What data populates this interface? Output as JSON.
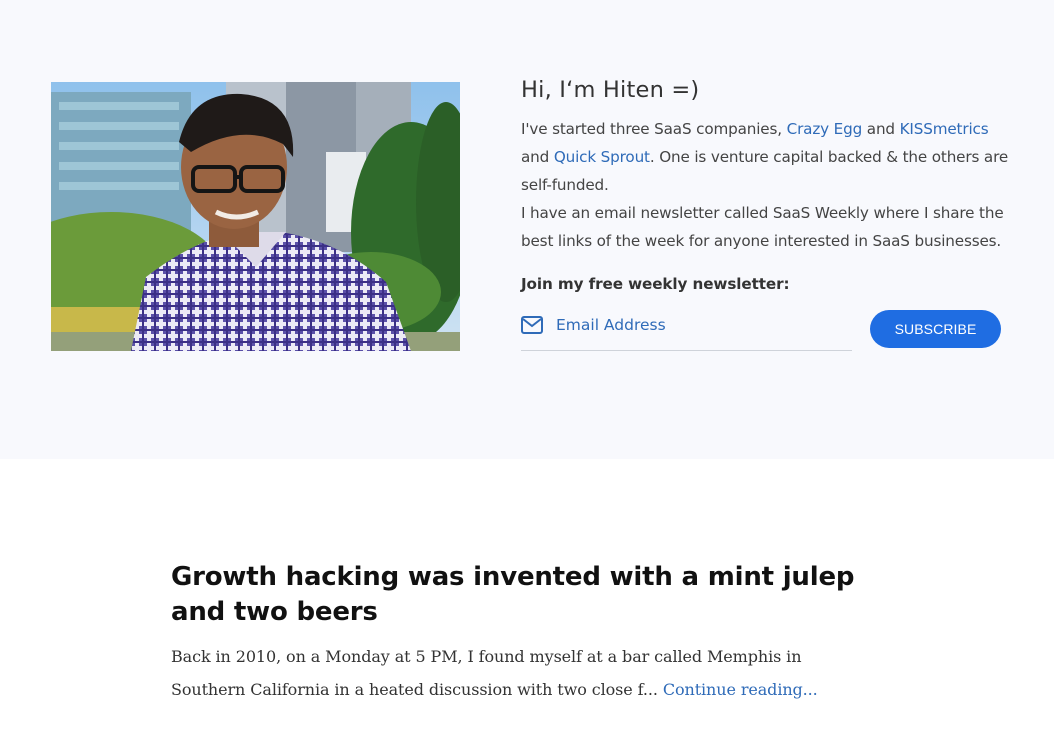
{
  "hero": {
    "greeting": "Hi, I‘m Hiten =)",
    "intro_prefix": "I've started three SaaS companies, ",
    "links": {
      "crazy_egg": "Crazy Egg",
      "kissmetrics": "KISSmetrics",
      "quick_sprout": "Quick Sprout"
    },
    "and_1": " and ",
    "and_2": "and ",
    "intro_suffix": ". One is venture capital backed & the others are self-funded.",
    "newsletter_text": "I have an email newsletter called SaaS Weekly where I share the best links of the week for anyone interested in SaaS businesses.",
    "join_label": "Join my free weekly newsletter:",
    "email_placeholder": "Email Address",
    "subscribe_label": "SUBSCRIBE",
    "photo_icon": "profile-photo"
  },
  "post": {
    "title": "Growth hacking was invented with a mint julep and two beers",
    "excerpt": "Back in 2010, on a Monday at 5 PM, I found myself at a bar called Memphis in Southern California in a heated discussion with two close f... ",
    "continue_label": "Continue reading..."
  },
  "colors": {
    "accent": "#1f6de2",
    "link": "#2f6bb8",
    "hero_bg": "#f8f9fd"
  }
}
